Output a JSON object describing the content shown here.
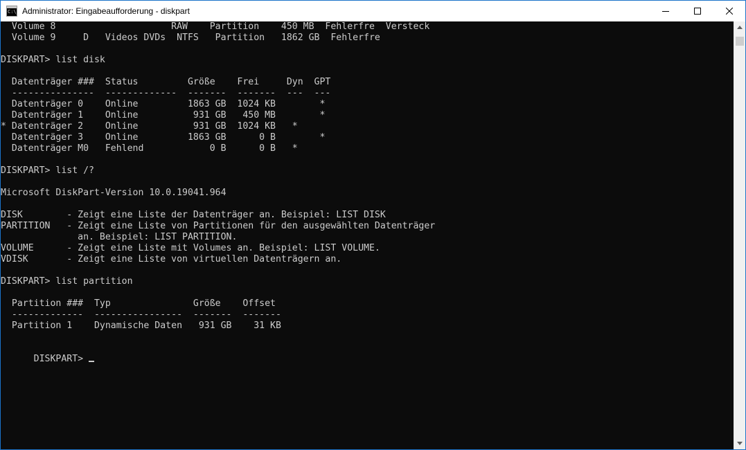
{
  "window": {
    "title": "Administrator: Eingabeaufforderung - diskpart",
    "icon_label": "C:\\_",
    "icon": "console-app-icon",
    "controls": [
      "minimize-icon",
      "maximize-icon",
      "close-icon"
    ]
  },
  "console": {
    "prompt": "DISKPART> ",
    "lines": [
      "  Volume 8                     RAW    Partition    450 MB  Fehlerfre  Versteck",
      "  Volume 9     D   Videos DVDs  NTFS   Partition   1862 GB  Fehlerfre",
      "",
      "DISKPART> list disk",
      "",
      "  Datenträger ###  Status         Größe    Frei     Dyn  GPT",
      "  ---------------  -------------  -------  -------  ---  ---",
      "  Datenträger 0    Online         1863 GB  1024 KB        *",
      "  Datenträger 1    Online          931 GB   450 MB        *",
      "* Datenträger 2    Online          931 GB  1024 KB   *",
      "  Datenträger 3    Online         1863 GB      0 B        *",
      "  Datenträger M0   Fehlend            0 B      0 B   *",
      "",
      "DISKPART> list /?",
      "",
      "Microsoft DiskPart-Version 10.0.19041.964",
      "",
      "DISK        - Zeigt eine Liste der Datenträger an. Beispiel: LIST DISK",
      "PARTITION   - Zeigt eine Liste von Partitionen für den ausgewählten Datenträger",
      "              an. Beispiel: LIST PARTITION.",
      "VOLUME      - Zeigt eine Liste mit Volumes an. Beispiel: LIST VOLUME.",
      "VDISK       - Zeigt eine Liste von virtuellen Datenträgern an.",
      "",
      "DISKPART> list partition",
      "",
      "  Partition ###  Typ               Größe    Offset",
      "  -------------  ----------------  -------  -------",
      "  Partition 1    Dynamische Daten   931 GB    31 KB",
      ""
    ]
  },
  "scrollbar": {
    "up_icon": "scroll-up-arrow-icon",
    "down_icon": "scroll-down-arrow-icon"
  }
}
